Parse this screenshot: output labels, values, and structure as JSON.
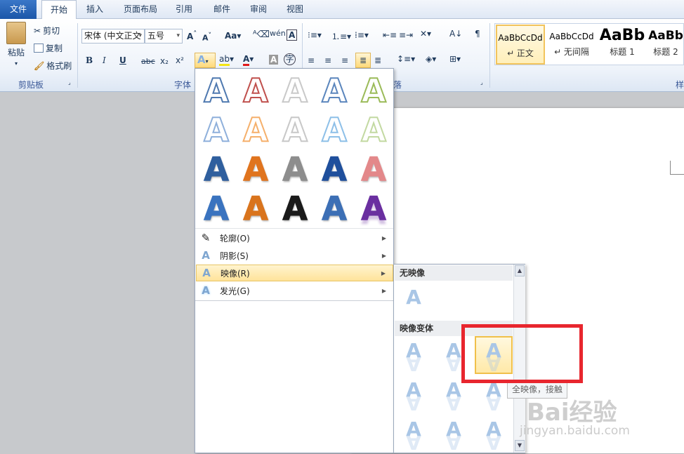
{
  "tabs": [
    "文件",
    "开始",
    "插入",
    "页面布局",
    "引用",
    "邮件",
    "审阅",
    "视图"
  ],
  "ribbon": {
    "clipboard": {
      "paste": "粘贴",
      "cut": "剪切",
      "copy": "复制",
      "format_painter": "格式刷",
      "group_label": "剪贴板"
    },
    "font": {
      "font_name": "宋体 (中文正文",
      "font_size": "五号",
      "group_label": "字体",
      "bold": "B",
      "italic": "I",
      "underline": "U",
      "strike": "abc",
      "subscript": "x₂",
      "superscript": "x²",
      "case_btn": "Aa"
    },
    "paragraph": {
      "group_label": "落"
    },
    "styles": {
      "items": [
        {
          "sample": "AaBbCcDd",
          "name": "↵ 正文"
        },
        {
          "sample": "AaBbCcDd",
          "name": "↵ 无间隔"
        },
        {
          "sample": "AaBb",
          "name": "标题 1"
        },
        {
          "sample": "AaBb",
          "name": "标题 2"
        }
      ],
      "group_label": "样"
    }
  },
  "effects_menu": {
    "glyph_char": "A",
    "glyph_colors": [
      [
        "#4f79b0",
        "#c0504d",
        "#c9c9c9",
        "#5b86bd",
        "#9bbb59"
      ],
      [
        "#8fb0db",
        "#f5b06c",
        "#c8c8c8",
        "#8ec0e8",
        "#c3d9a2"
      ],
      [
        "#2f5f9e",
        "#e0741e",
        "#8d8d8d",
        "#1f4f9c",
        "#e3888a"
      ],
      [
        "#3a73bf",
        "#d9741d",
        "#1a1a1a",
        "#3c6fb5",
        "#6a2fa0"
      ]
    ],
    "items": [
      {
        "label": "轮廓(O)",
        "icon": "pen-outline-icon"
      },
      {
        "label": "阴影(S)",
        "icon": "shadow-a-icon"
      },
      {
        "label": "映像(R)",
        "icon": "reflection-a-icon"
      },
      {
        "label": "发光(G)",
        "icon": "glow-a-icon"
      }
    ]
  },
  "reflection_submenu": {
    "no_reflection_header": "无映像",
    "variants_header": "映像变体",
    "glyph_char": "A"
  },
  "tooltip": "全映像，接触",
  "watermark": {
    "line1": "Bai经验",
    "line2": "jingyan.baidu.com"
  },
  "colors": {
    "accent": "#1b56a8",
    "highlight": "#e8262e",
    "hover": "#ffe39a"
  }
}
